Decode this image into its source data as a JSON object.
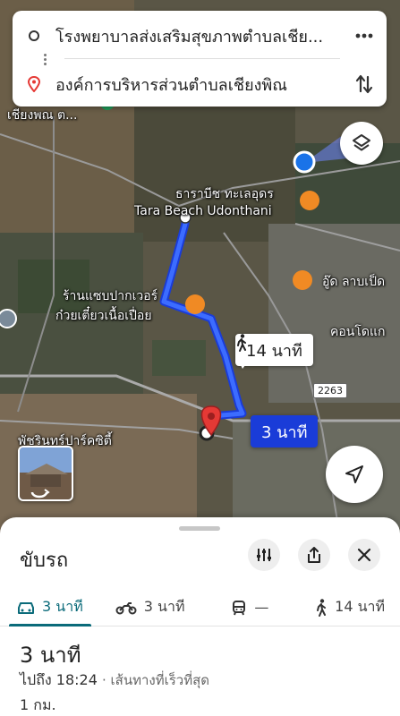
{
  "directions": {
    "origin": "โรงพยาบาลส่งเสริมสุขภาพตำบลเชีย...",
    "destination": "องค์การบริหารส่วนตำบลเชียงพิณ"
  },
  "map": {
    "labels": {
      "top_left": "เชียงพณ ต...",
      "place1_line1": "ธาราบีช ทะเลอุดร",
      "place1_line2": "Tara Beach Udonthani",
      "place2_line1": "ร้านแซบปากเวอร์",
      "place2_line2": "ก๋วยเตี๋ยวเนื้อเปื่อย",
      "place3": "อู๊ด ลาบเป็ด",
      "place4": "คอนโดแก",
      "place5": "พัชรินทร์ปาร์คซิตี้"
    },
    "road_number": "2263",
    "walk_chip": "14 นาที",
    "drive_chip": "3 นาที"
  },
  "sheet": {
    "title": "ขับรถ",
    "modes": [
      {
        "icon": "car-icon",
        "label": "3 นาที"
      },
      {
        "icon": "motorcycle-icon",
        "label": "3 นาที"
      },
      {
        "icon": "transit-icon",
        "label": "—"
      },
      {
        "icon": "walk-icon",
        "label": "14 นาที"
      }
    ],
    "summary": {
      "duration": "3 นาที",
      "arrive": "ไปถึง 18:24",
      "note": "· เส้นทางที่เร็วที่สุด",
      "distance": "1 กม."
    }
  },
  "colors": {
    "route": "#1a3cd8",
    "active_tab": "#0b6b7a",
    "pin": "#e53935",
    "poi": "#f08a24"
  }
}
